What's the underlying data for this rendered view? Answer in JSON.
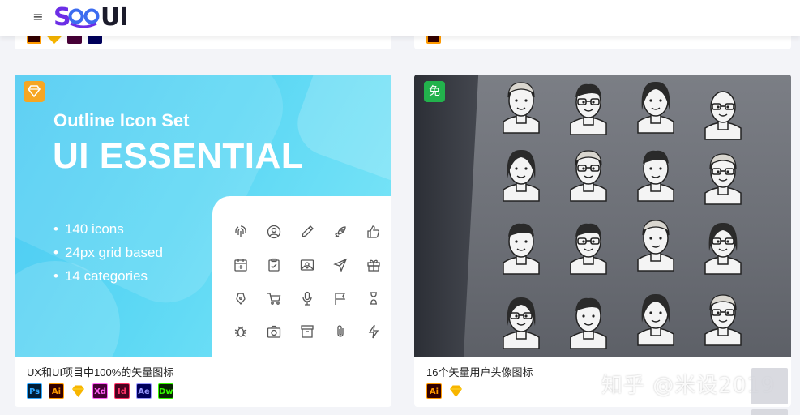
{
  "header": {
    "menu_icon": "hamburger-icon",
    "logo_text": "SOOUI",
    "brand_colors": [
      "#6c2ee6",
      "#3c6cf0",
      "#1b1b2b"
    ]
  },
  "cards": [
    {
      "title": "UX和UI项目中100%的矢量图标",
      "corner_icon": "sketch-diamond-icon",
      "thumbnail": {
        "subtitle": "Outline Icon Set",
        "heading": "UI ESSENTIAL",
        "features": [
          "140 icons",
          "24px grid based",
          "14 categories"
        ]
      },
      "badges": [
        {
          "label": "Ps",
          "name": "photoshop",
          "bg": "#001e36",
          "fg": "#31a8ff"
        },
        {
          "label": "Ai",
          "name": "illustrator",
          "bg": "#330000",
          "fg": "#ff9a00"
        },
        {
          "label": "",
          "name": "sketch",
          "bg": "#f7b500",
          "fg": "#f7b500"
        },
        {
          "label": "Xd",
          "name": "xd",
          "bg": "#470137",
          "fg": "#ff61f6"
        },
        {
          "label": "Id",
          "name": "indesign",
          "bg": "#49021f",
          "fg": "#ff3366"
        },
        {
          "label": "Ae",
          "name": "after-effects",
          "bg": "#00005b",
          "fg": "#9999ff"
        },
        {
          "label": "Dw",
          "name": "dreamweaver",
          "bg": "#072401",
          "fg": "#35fa00"
        }
      ]
    },
    {
      "title": "16个矢量用户头像图标",
      "corner_label": "免",
      "badges": [
        {
          "label": "Ai",
          "name": "illustrator",
          "bg": "#330000",
          "fg": "#ff9a00"
        },
        {
          "label": "",
          "name": "sketch",
          "bg": "#f7b500",
          "fg": "#f7b500"
        }
      ]
    }
  ],
  "watermark": "知乎 @米设2019"
}
